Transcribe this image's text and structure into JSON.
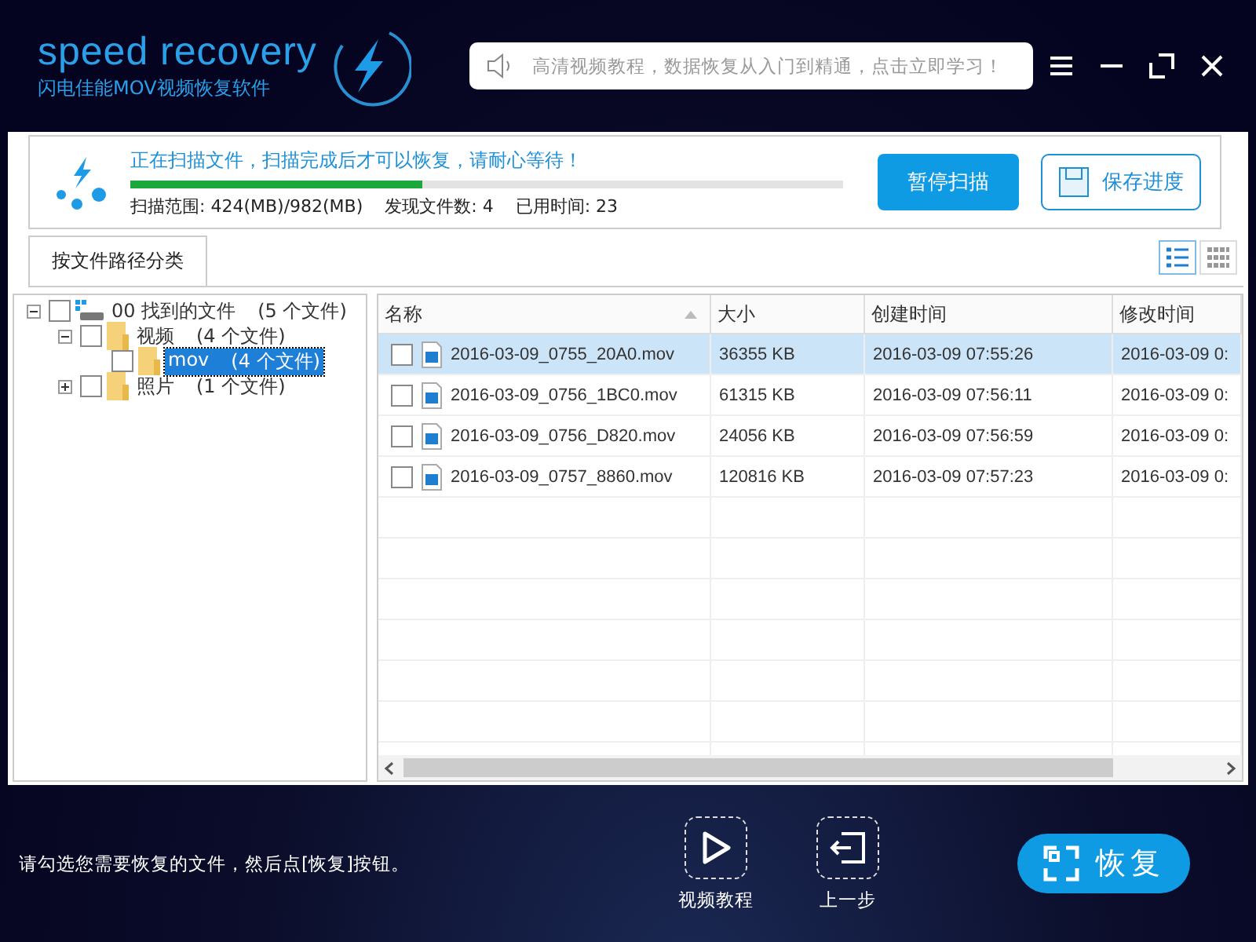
{
  "header": {
    "logo_title": "speed recovery",
    "logo_subtitle": "闪电佳能MOV视频恢复软件",
    "notice": "高清视频教程，数据恢复从入门到精通，点击立即学习！"
  },
  "scan": {
    "message": "正在扫描文件，扫描完成后才可以恢复，请耐心等待！",
    "level": 0.41,
    "range": "扫描范围: 424(MB)/982(MB)",
    "found": "发现文件数: 4",
    "elapsed": "已用时间: 23",
    "pause_button": "暂停扫描",
    "save_button": "保存进度"
  },
  "tabs": [
    {
      "label": "按文件路径分类",
      "selected": true
    }
  ],
  "view_modes": [
    {
      "kind": "list",
      "selected": true
    },
    {
      "kind": "grid",
      "selected": false
    }
  ],
  "tree": [
    {
      "label": "00 找到的文件",
      "count": "(5 个文件)",
      "kind": "drive",
      "expanded": true,
      "checked": false,
      "selected": false,
      "children": [
        {
          "label": "视频",
          "count": "(4 个文件)",
          "kind": "folder",
          "expanded": true,
          "checked": false,
          "selected": false,
          "children": [
            {
              "label": "mov",
              "count": "(4 个文件)",
              "kind": "folder",
              "checked": false,
              "selected": true
            }
          ]
        },
        {
          "label": "照片",
          "count": "(1 个文件)",
          "kind": "folder",
          "expanded": false,
          "checked": false,
          "selected": false
        }
      ]
    }
  ],
  "table": {
    "columns": [
      "名称",
      "大小",
      "创建时间",
      "修改时间"
    ],
    "rows": [
      {
        "name": "2016-03-09_0755_20A0.mov",
        "size": "36355 KB",
        "created": "2016-03-09  07:55:26",
        "modified": "2016-03-09  0:",
        "checked": false,
        "selected": true
      },
      {
        "name": "2016-03-09_0756_1BC0.mov",
        "size": "61315 KB",
        "created": "2016-03-09  07:56:11",
        "modified": "2016-03-09  0:",
        "checked": false,
        "selected": false
      },
      {
        "name": "2016-03-09_0756_D820.mov",
        "size": "24056 KB",
        "created": "2016-03-09  07:56:59",
        "modified": "2016-03-09  0:",
        "checked": false,
        "selected": false
      },
      {
        "name": "2016-03-09_0757_8860.mov",
        "size": "120816 KB",
        "created": "2016-03-09  07:57:23",
        "modified": "2016-03-09  0:",
        "checked": false,
        "selected": false
      }
    ]
  },
  "footer": {
    "hint": "请勾选您需要恢复的文件，然后点[恢复]按钮。",
    "video_tutorial": "视频教程",
    "back": "上一步",
    "recover_button": "恢复"
  }
}
